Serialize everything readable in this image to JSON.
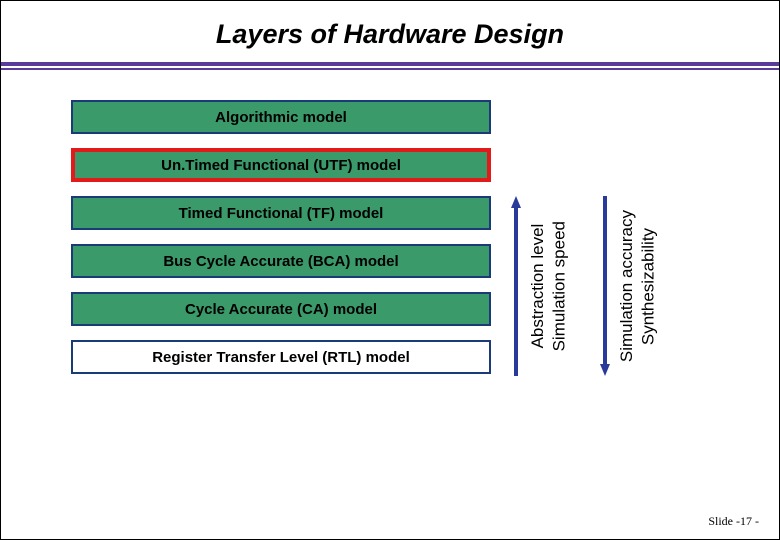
{
  "title": "Layers of Hardware Design",
  "layers": {
    "l0": "Algorithmic model",
    "l1": "Un.Timed Functional (UTF) model",
    "l2": "Timed Functional (TF) model",
    "l3": "Bus Cycle Accurate (BCA) model",
    "l4": "Cycle Accurate (CA) model",
    "l5": "Register Transfer Level (RTL) model"
  },
  "arrows": {
    "left_label1": "Abstraction level",
    "left_label2": "Simulation speed",
    "right_label1": "Simulation accuracy",
    "right_label2": "Synthesizability"
  },
  "footer": "Slide -17 -",
  "colors": {
    "green": "#3a9a6a",
    "blue_border": "#1a3a7a",
    "red_border": "#e21a1a",
    "purple": "#5a3a9a",
    "arrow_blue": "#2a3a9a"
  }
}
